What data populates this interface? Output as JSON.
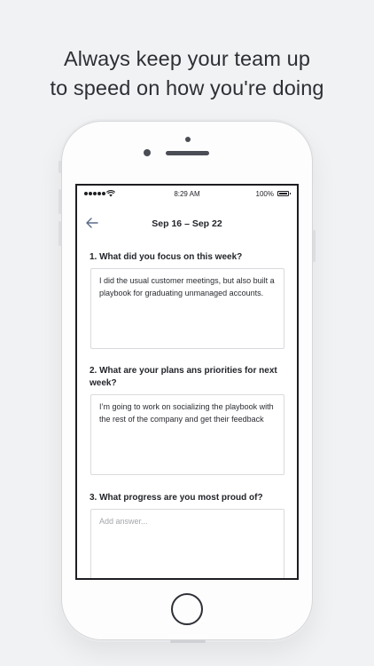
{
  "headline": {
    "line1": "Always keep your team up",
    "line2": "to speed on how you're doing"
  },
  "status_bar": {
    "time": "8:29 AM",
    "battery": "100%"
  },
  "nav": {
    "title": "Sep 16 – Sep 22",
    "back_icon": "back-arrow-icon"
  },
  "questions": [
    {
      "label": "1. What did you focus on this week?",
      "answer": "I did the usual customer meetings, but also built a playbook for graduating unmanaged accounts."
    },
    {
      "label": "2. What are your plans ans priorities for next week?",
      "answer": "I’m going to work on socializing the playbook with the rest of the company and get their feedback"
    },
    {
      "label": "3. What progress are you most proud of?",
      "placeholder": "Add answer..."
    }
  ],
  "colors": {
    "background": "#f1f2f4",
    "text": "#23252a",
    "input_border": "#d8dadd"
  }
}
